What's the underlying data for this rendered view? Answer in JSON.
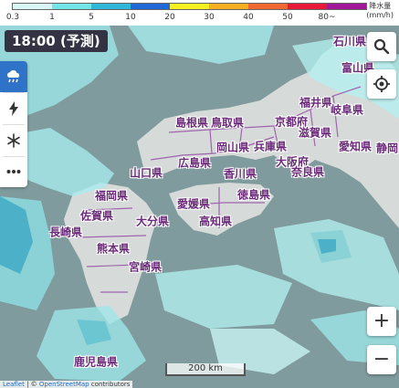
{
  "legend": {
    "ticks": [
      "0.3",
      "1",
      "5",
      "10",
      "20",
      "30",
      "40",
      "50",
      "80~"
    ],
    "colors": [
      "#d8f8f8",
      "#72e6e6",
      "#2fb8d8",
      "#2068d8",
      "#f8f020",
      "#f8b020",
      "#f06830",
      "#e81838",
      "#a01898"
    ],
    "unit_line1": "降水量",
    "unit_line2": "(mm/h)"
  },
  "time": {
    "label": "18:00 (予測)"
  },
  "layers": [
    {
      "name": "rain",
      "icon": "rain-cloud-icon",
      "active": true
    },
    {
      "name": "lightning",
      "icon": "lightning-icon",
      "active": false
    },
    {
      "name": "snow",
      "icon": "snowflake-icon",
      "active": false
    },
    {
      "name": "more",
      "icon": "more-icon",
      "active": false
    }
  ],
  "controls": {
    "zoom_in": "+",
    "zoom_out": "−"
  },
  "prefectures": [
    "石川県",
    "富山県",
    "福井県",
    "岐阜県",
    "島根県",
    "鳥取県",
    "京都府",
    "滋賀県",
    "愛知県",
    "静岡",
    "岡山県",
    "兵庫県",
    "山口県",
    "広島県",
    "香川県",
    "大阪府",
    "奈良県",
    "愛媛県",
    "徳島県",
    "福岡県",
    "佐賀県",
    "大分県",
    "高知県",
    "長崎県",
    "熊本県",
    "宮崎県",
    "鹿児島県"
  ],
  "scale": {
    "label": "200 km"
  },
  "attribution": {
    "leaflet": "Leaflet",
    "sep": " | © ",
    "osm": "OpenStreetMap",
    "tail": " contributors"
  }
}
